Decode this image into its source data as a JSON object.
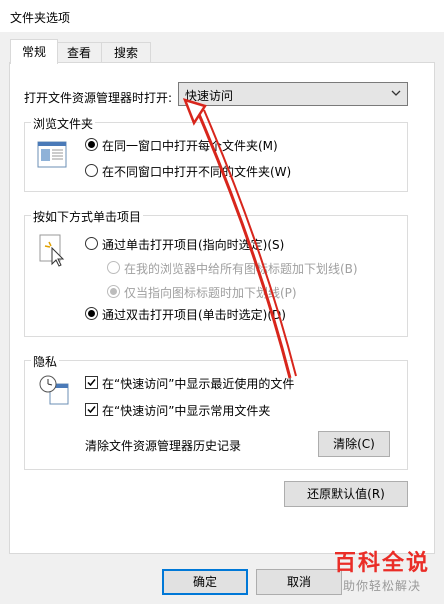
{
  "window": {
    "title": "文件夹选项"
  },
  "tabs": [
    {
      "label": "常规"
    },
    {
      "label": "查看"
    },
    {
      "label": "搜索"
    }
  ],
  "general": {
    "open_label": "打开文件资源管理器时打开:",
    "open_value": "快速访问",
    "browse": {
      "title": "浏览文件夹",
      "opt_same": "在同一窗口中打开每个文件夹(M)",
      "opt_new": "在不同窗口中打开不同的文件夹(W)"
    },
    "click": {
      "title": "按如下方式单击项目",
      "opt_single": "通过单击打开项目(指向时选定)(S)",
      "sub_browser": "在我的浏览器中给所有图标标题加下划线(B)",
      "sub_point": "仅当指向图标标题时加下划线(P)",
      "opt_double": "通过双击打开项目(单击时选定)(D)"
    },
    "privacy": {
      "title": "隐私",
      "show_recent": "在“快速访问”中显示最近使用的文件",
      "show_frequent": "在“快速访问”中显示常用文件夹",
      "clear_label": "清除文件资源管理器历史记录",
      "clear_button": "清除(C)"
    },
    "restore_button": "还原默认值(R)"
  },
  "footer": {
    "ok": "确定",
    "cancel": "取消"
  },
  "watermark": {
    "title": "百科全说",
    "subtitle": "助你轻松解决"
  },
  "colors": {
    "arrow": "#d8261c",
    "accent": "#0078d7"
  }
}
